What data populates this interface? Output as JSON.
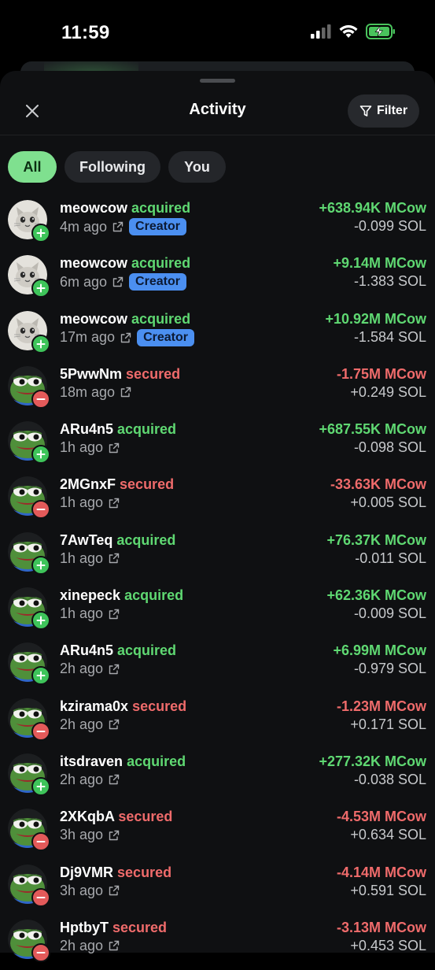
{
  "status": {
    "time": "11:59"
  },
  "header": {
    "title": "Activity",
    "filter_label": "Filter"
  },
  "tabs": [
    {
      "label": "All"
    },
    {
      "label": "Following"
    },
    {
      "label": "You"
    }
  ],
  "colors": {
    "acquired": "#5fd872",
    "secured": "#ef6b6b",
    "accent": "#7fe08f",
    "creator": "#4b8ff0"
  },
  "items": [
    {
      "user": "meowcow",
      "action": "acquired",
      "time": "4m ago",
      "creator": "Creator",
      "amount": "+638.94K MCow",
      "sol": "-0.099 SOL",
      "avatar": "cat-avatar"
    },
    {
      "user": "meowcow",
      "action": "acquired",
      "time": "6m ago",
      "creator": "Creator",
      "amount": "+9.14M MCow",
      "sol": "-1.383 SOL",
      "avatar": "cat-avatar"
    },
    {
      "user": "meowcow",
      "action": "acquired",
      "time": "17m ago",
      "creator": "Creator",
      "amount": "+10.92M MCow",
      "sol": "-1.584 SOL",
      "avatar": "cat-avatar"
    },
    {
      "user": "5PwwNm",
      "action": "secured",
      "time": "18m ago",
      "amount": "-1.75M MCow",
      "sol": "+0.249 SOL",
      "avatar": "frog-avatar"
    },
    {
      "user": "ARu4n5",
      "action": "acquired",
      "time": "1h ago",
      "amount": "+687.55K MCow",
      "sol": "-0.098 SOL",
      "avatar": "frog-avatar"
    },
    {
      "user": "2MGnxF",
      "action": "secured",
      "time": "1h ago",
      "amount": "-33.63K MCow",
      "sol": "+0.005 SOL",
      "avatar": "frog-avatar"
    },
    {
      "user": "7AwTeq",
      "action": "acquired",
      "time": "1h ago",
      "amount": "+76.37K MCow",
      "sol": "-0.011 SOL",
      "avatar": "frog-avatar"
    },
    {
      "user": "xinepeck",
      "action": "acquired",
      "time": "1h ago",
      "amount": "+62.36K MCow",
      "sol": "-0.009 SOL",
      "avatar": "frog-avatar"
    },
    {
      "user": "ARu4n5",
      "action": "acquired",
      "time": "2h ago",
      "amount": "+6.99M MCow",
      "sol": "-0.979 SOL",
      "avatar": "frog-avatar"
    },
    {
      "user": "kzirama0x",
      "action": "secured",
      "time": "2h ago",
      "amount": "-1.23M MCow",
      "sol": "+0.171 SOL",
      "avatar": "frog-avatar"
    },
    {
      "user": "itsdraven",
      "action": "acquired",
      "time": "2h ago",
      "amount": "+277.32K MCow",
      "sol": "-0.038 SOL",
      "avatar": "frog-avatar"
    },
    {
      "user": "2XKqbA",
      "action": "secured",
      "time": "3h ago",
      "amount": "-4.53M MCow",
      "sol": "+0.634 SOL",
      "avatar": "frog-avatar"
    },
    {
      "user": "Dj9VMR",
      "action": "secured",
      "time": "3h ago",
      "amount": "-4.14M MCow",
      "sol": "+0.591 SOL",
      "avatar": "frog-avatar"
    },
    {
      "user": "HptbyT",
      "action": "secured",
      "time": "2h ago",
      "amount": "-3.13M MCow",
      "sol": "+0.453 SOL",
      "avatar": "frog-avatar"
    }
  ]
}
